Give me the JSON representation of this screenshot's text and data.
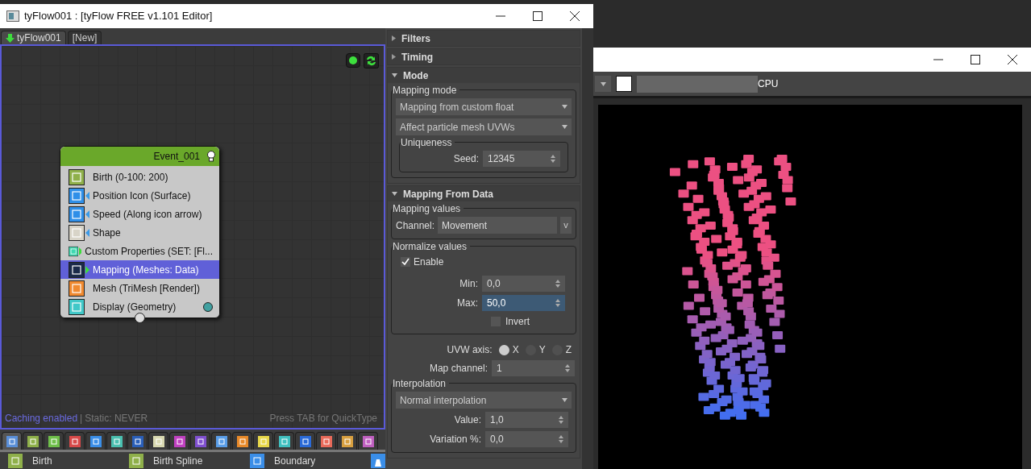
{
  "editor_window": {
    "title": "tyFlow001 : [tyFlow FREE v1.101 Editor]"
  },
  "flow_tabs": [
    {
      "label": "tyFlow001",
      "selected": true
    },
    {
      "label": "[New]",
      "selected": false
    }
  ],
  "event": {
    "title": "Event_001",
    "operators": [
      {
        "label": "Birth (0-100: 200)",
        "color": "#8fb04a",
        "kind": "plain",
        "selected": false
      },
      {
        "label": "Position Icon (Surface)",
        "color": "#2f8fe8",
        "kind": "input",
        "selected": false
      },
      {
        "label": "Speed (Along icon arrow)",
        "color": "#2f8fe8",
        "kind": "input",
        "selected": false
      },
      {
        "label": "Shape",
        "color": "#d8d4c8",
        "kind": "input",
        "selected": false
      },
      {
        "label": "Custom Properties (SET: [Fl...",
        "color": "#3fd8b0",
        "kind": "output",
        "selected": false
      },
      {
        "label": "Mapping (Meshes: Data)",
        "color": "#1a2a4a",
        "kind": "output",
        "selected": true
      },
      {
        "label": "Mesh (TriMesh [Render])",
        "color": "#f08a30",
        "kind": "plain",
        "selected": false
      },
      {
        "label": "Display (Geometry)",
        "color": "#40c8c8",
        "kind": "display",
        "selected": false
      }
    ]
  },
  "status": {
    "caching": "Caching enabled",
    "separator": "|",
    "static": "Static: NEVER",
    "hint": "Press TAB for QuickType"
  },
  "operator_categories": [
    {
      "color": "#5a8fd8",
      "selected": true
    },
    {
      "color": "#8fb04a",
      "selected": false
    },
    {
      "color": "#6fbf4a",
      "selected": false
    },
    {
      "color": "#d84a4a",
      "selected": false
    },
    {
      "color": "#3a8ee8",
      "selected": false
    },
    {
      "color": "#4ac0b0",
      "selected": false
    },
    {
      "color": "#2a5fb8",
      "selected": false
    },
    {
      "color": "#d8d8b0",
      "selected": false
    },
    {
      "color": "#c040c0",
      "selected": false
    },
    {
      "color": "#8050d0",
      "selected": false
    },
    {
      "color": "#5a9ee8",
      "selected": false
    },
    {
      "color": "#e88a2a",
      "selected": false
    },
    {
      "color": "#e8d84a",
      "selected": false
    },
    {
      "color": "#40c0c0",
      "selected": false
    },
    {
      "color": "#2a6ad8",
      "selected": false
    },
    {
      "color": "#e86a5a",
      "selected": false
    },
    {
      "color": "#d8a040",
      "selected": false
    },
    {
      "color": "#c060c0",
      "selected": false
    }
  ],
  "operator_list": [
    {
      "label": "Birth",
      "color": "#8fb04a"
    },
    {
      "label": "Birth Spline",
      "color": "#8fb04a"
    },
    {
      "label": "Boundary",
      "color": "#3a8ee8"
    }
  ],
  "rollouts": [
    {
      "title": "Filters",
      "expanded": false
    },
    {
      "title": "Timing",
      "expanded": false
    },
    {
      "title": "Mode",
      "expanded": true,
      "kind": "mode"
    },
    {
      "title": "Mapping From Data",
      "expanded": true,
      "kind": "mapping"
    }
  ],
  "mode": {
    "group": "Mapping mode",
    "dropdowns": [
      "Mapping from custom float",
      "Affect particle mesh UVWs"
    ],
    "uniqueness": {
      "label": "Uniqueness",
      "seed_label": "Seed:",
      "seed": "12345"
    }
  },
  "mapping": {
    "values_group": "Mapping values",
    "channel_label": "Channel:",
    "channel": "Movement",
    "channel_button": "v",
    "normalize": {
      "label": "Normalize values",
      "enable": {
        "label": "Enable",
        "checked": true
      },
      "min": {
        "label": "Min:",
        "value": "0,0",
        "focused": false
      },
      "max": {
        "label": "Max:",
        "value": "50,0",
        "focused": true
      },
      "invert": {
        "label": "Invert",
        "checked": false
      }
    },
    "uvw_axis": {
      "label": "UVW axis:",
      "options": [
        {
          "label": "X",
          "selected": true
        },
        {
          "label": "Y",
          "selected": false
        },
        {
          "label": "Z",
          "selected": false
        }
      ]
    },
    "map_channel": {
      "label": "Map channel:",
      "value": "1"
    },
    "interpolation": {
      "label": "Interpolation",
      "dropdown": "Normal interpolation",
      "value": {
        "label": "Value:",
        "value": "1,0"
      },
      "variation": {
        "label": "Variation %:",
        "value": "0,0"
      }
    }
  },
  "render_window": {
    "toolbar_label": "CPU"
  }
}
